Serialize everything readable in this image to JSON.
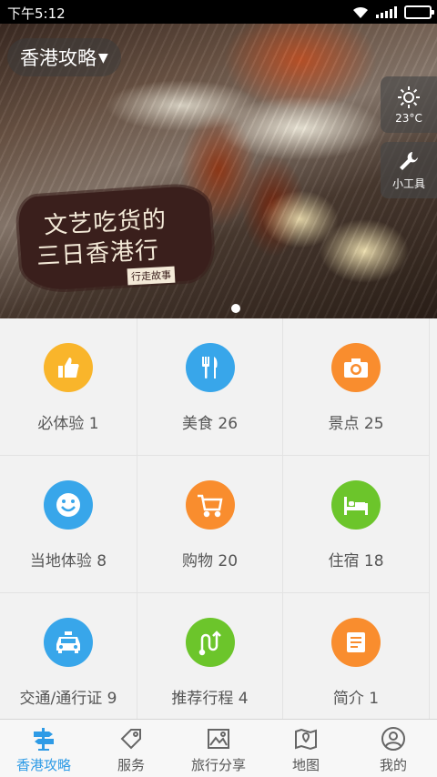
{
  "status": {
    "time": "下午5:12"
  },
  "banner": {
    "city": "香港攻略",
    "logo_line1": "文艺吃货的",
    "logo_line2": "三日香港行",
    "logo_tag": "行走故事",
    "weather_temp": "23°C",
    "tools_label": "小工具"
  },
  "categories": [
    {
      "label": "必体验 1",
      "icon": "thumbs-up-icon",
      "color": "#f9b52b"
    },
    {
      "label": "美食 26",
      "icon": "fork-knife-icon",
      "color": "#38a6ea"
    },
    {
      "label": "景点 25",
      "icon": "camera-icon",
      "color": "#f98d2e"
    },
    {
      "label": "当地体验 8",
      "icon": "smiley-icon",
      "color": "#38a6ea"
    },
    {
      "label": "购物 20",
      "icon": "shopping-cart-icon",
      "color": "#f98d2e"
    },
    {
      "label": "住宿 18",
      "icon": "bed-icon",
      "color": "#6cc52b"
    },
    {
      "label": "交通/通行证 9",
      "icon": "taxi-icon",
      "color": "#38a6ea"
    },
    {
      "label": "推荐行程 4",
      "icon": "route-icon",
      "color": "#6cc52b"
    },
    {
      "label": "简介 1",
      "icon": "document-icon",
      "color": "#f98d2e"
    }
  ],
  "tabs": [
    {
      "label": "香港攻略",
      "icon": "signpost-icon",
      "active": true
    },
    {
      "label": "服务",
      "icon": "tag-icon",
      "active": false
    },
    {
      "label": "旅行分享",
      "icon": "picture-icon",
      "active": false
    },
    {
      "label": "地图",
      "icon": "map-icon",
      "active": false
    },
    {
      "label": "我的",
      "icon": "user-icon",
      "active": false
    }
  ]
}
